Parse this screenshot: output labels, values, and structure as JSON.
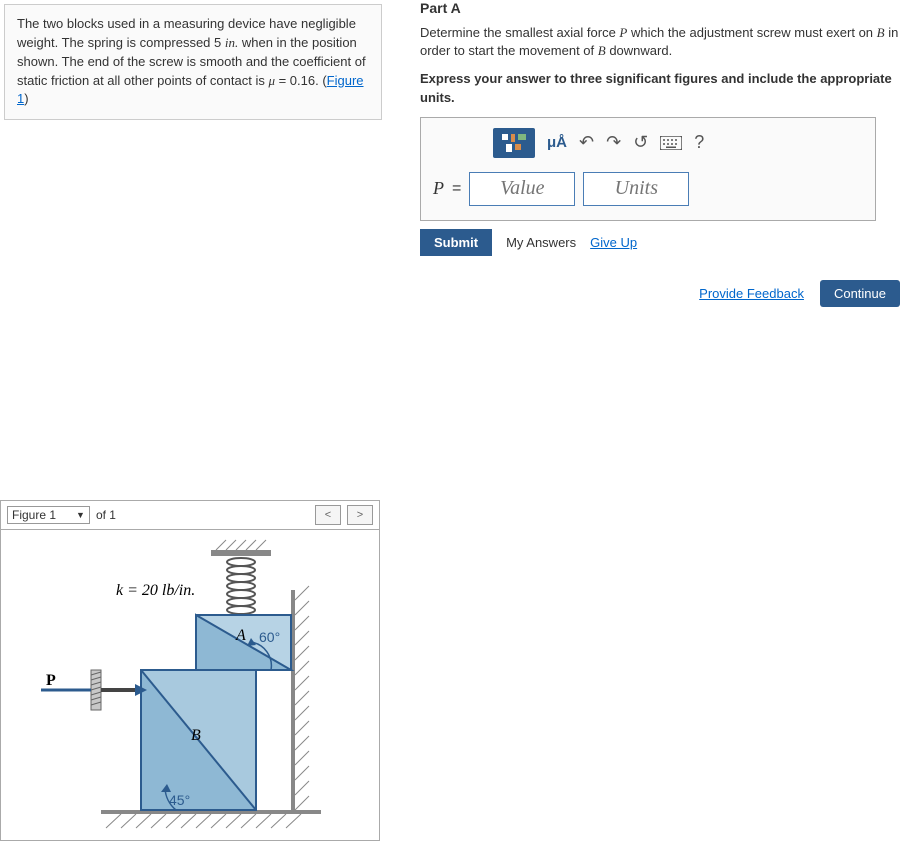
{
  "problem": {
    "text1": "The two blocks used in a measuring device have negligible weight. The spring is compressed 5 ",
    "unit1": "in.",
    "text2": " when in the position shown. The end of the screw is smooth and the coefficient of static friction at all other points of contact is ",
    "mu_var": "μ",
    "mu_val": " = 0.16. (",
    "figure_link": "Figure 1",
    "text3": ")"
  },
  "figure_nav": {
    "select_label": "Figure 1",
    "of_label": "of 1"
  },
  "figure_labels": {
    "k_label": "k = 20 lb/in.",
    "P": "P",
    "A": "A",
    "B": "B",
    "angle60": "60°",
    "angle45": "45°"
  },
  "partA": {
    "title": "Part A",
    "prompt1": "Determine the smallest axial force ",
    "var_P": "P",
    "prompt2": " which the adjustment screw must exert on ",
    "var_B": "B",
    "prompt3": " in order to start the movement of ",
    "prompt4": " downward.",
    "instruction": "Express your answer to three significant figures and include the appropriate units."
  },
  "toolbar": {
    "greek_label": "μÅ",
    "help_label": "?"
  },
  "answer": {
    "label": "P",
    "eq": "=",
    "value_placeholder": "Value",
    "units_placeholder": "Units"
  },
  "actions": {
    "submit": "Submit",
    "my_answers": "My Answers",
    "give_up": "Give Up",
    "provide_feedback": "Provide Feedback",
    "continue": "Continue"
  }
}
